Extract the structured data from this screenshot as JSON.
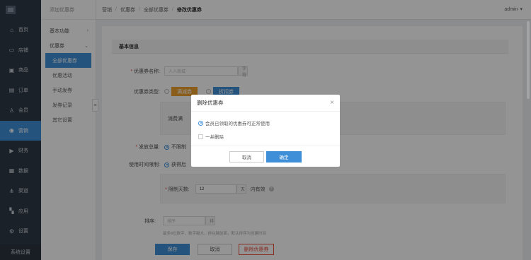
{
  "sidebar": {
    "items": [
      {
        "label": "首页",
        "icon": "home-icon",
        "glyph": "⌂"
      },
      {
        "label": "店铺",
        "icon": "shop-icon",
        "glyph": "▭"
      },
      {
        "label": "商品",
        "icon": "goods-icon",
        "glyph": "▣"
      },
      {
        "label": "订单",
        "icon": "order-icon",
        "glyph": "▤"
      },
      {
        "label": "会员",
        "icon": "user-icon",
        "glyph": "♙"
      },
      {
        "label": "营销",
        "icon": "marketing-icon",
        "glyph": "◉"
      },
      {
        "label": "财务",
        "icon": "finance-icon",
        "glyph": "▶"
      },
      {
        "label": "数据",
        "icon": "data-icon",
        "glyph": "▦"
      },
      {
        "label": "渠道",
        "icon": "channel-icon",
        "glyph": "⋔"
      },
      {
        "label": "应用",
        "icon": "apps-icon",
        "glyph": "▚"
      },
      {
        "label": "设置",
        "icon": "settings-icon",
        "glyph": "⚙"
      }
    ],
    "bottom": "系统设置"
  },
  "subnav": {
    "header": "添加优惠券",
    "group1": "基本功能",
    "group2": "优惠券",
    "children": [
      "全部优惠券",
      "优惠活动",
      "手动发券",
      "发券记录",
      "其它设置"
    ]
  },
  "topbar": {
    "crumbs": [
      "营销",
      "优惠券",
      "全部优惠券"
    ],
    "current": "修改优惠券",
    "user": "admin"
  },
  "form": {
    "section_title": "基本信息",
    "name_label": "优惠券名称:",
    "name_placeholder": "人人商城",
    "name_suffix": "字符",
    "type_label": "优惠券类型:",
    "type_opt1": "满减券",
    "type_opt2": "折扣券",
    "fullcut_label": "消费满",
    "total_label": "发放总量:",
    "total_opt": "不限制",
    "time_label": "使用时间限制:",
    "time_opt": "获得后",
    "limit_label": "限制天数:",
    "limit_value": "12",
    "limit_unit": "天",
    "limit_suffix": "内有效",
    "sort_label": "排序:",
    "sort_placeholder": "排序",
    "sort_suffix": "排",
    "sort_hint": "最多8位数字，数字越大，排在越前面，默认排序为创建时间",
    "save": "保存",
    "cancel": "取消",
    "delete": "删除优惠券"
  },
  "dialog": {
    "title": "删除优惠券",
    "option1": "会员已领取的优惠券可正常使用",
    "option2": "一并删除",
    "cancel": "取消",
    "ok": "确定"
  }
}
